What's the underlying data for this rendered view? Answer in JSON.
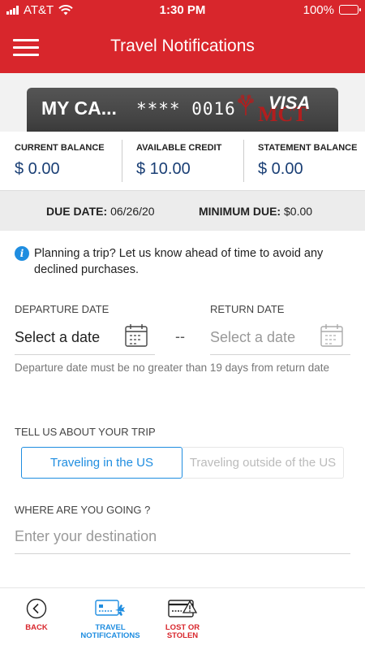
{
  "status_bar": {
    "carrier": "AT&T",
    "time": "1:30 PM",
    "battery": "100%",
    "battery_level": 1.0
  },
  "header": {
    "title": "Travel Notifications"
  },
  "card": {
    "name": "MY CA...",
    "number": "**** 0016",
    "brand": "VISA",
    "logo_text": "MCT"
  },
  "balances": [
    {
      "label": "CURRENT BALANCE",
      "value": "$ 0.00"
    },
    {
      "label": "AVAILABLE CREDIT",
      "value": "$ 10.00"
    },
    {
      "label": "STATEMENT BALANCE",
      "value": "$ 0.00"
    }
  ],
  "due": {
    "date_label": "DUE DATE:",
    "date_value": "06/26/20",
    "min_label": "MINIMUM DUE:",
    "min_value": "$0.00"
  },
  "info": {
    "text": "Planning a trip? Let us know ahead of time to avoid any declined purchases."
  },
  "departure": {
    "label": "DEPARTURE DATE",
    "value": "Select a date"
  },
  "return": {
    "label": "RETURN DATE",
    "placeholder": "Select a date"
  },
  "separator": "--",
  "hint": "Departure date must be no greater than 19 days from return date",
  "trip": {
    "label": "TELL US ABOUT YOUR TRIP",
    "options": [
      "Traveling in the US",
      "Traveling outside of the US"
    ],
    "selected": "Traveling in the US"
  },
  "destination": {
    "label": "WHERE ARE YOU GOING ?",
    "placeholder": "Enter your destination"
  },
  "nav": {
    "back": "BACK",
    "travel": "TRAVEL NOTIFICATIONS",
    "lost": "LOST OR STOLEN"
  },
  "colors": {
    "brand_red": "#d8262c",
    "accent_blue": "#1f8de0",
    "balance_blue": "#1a3f75"
  }
}
